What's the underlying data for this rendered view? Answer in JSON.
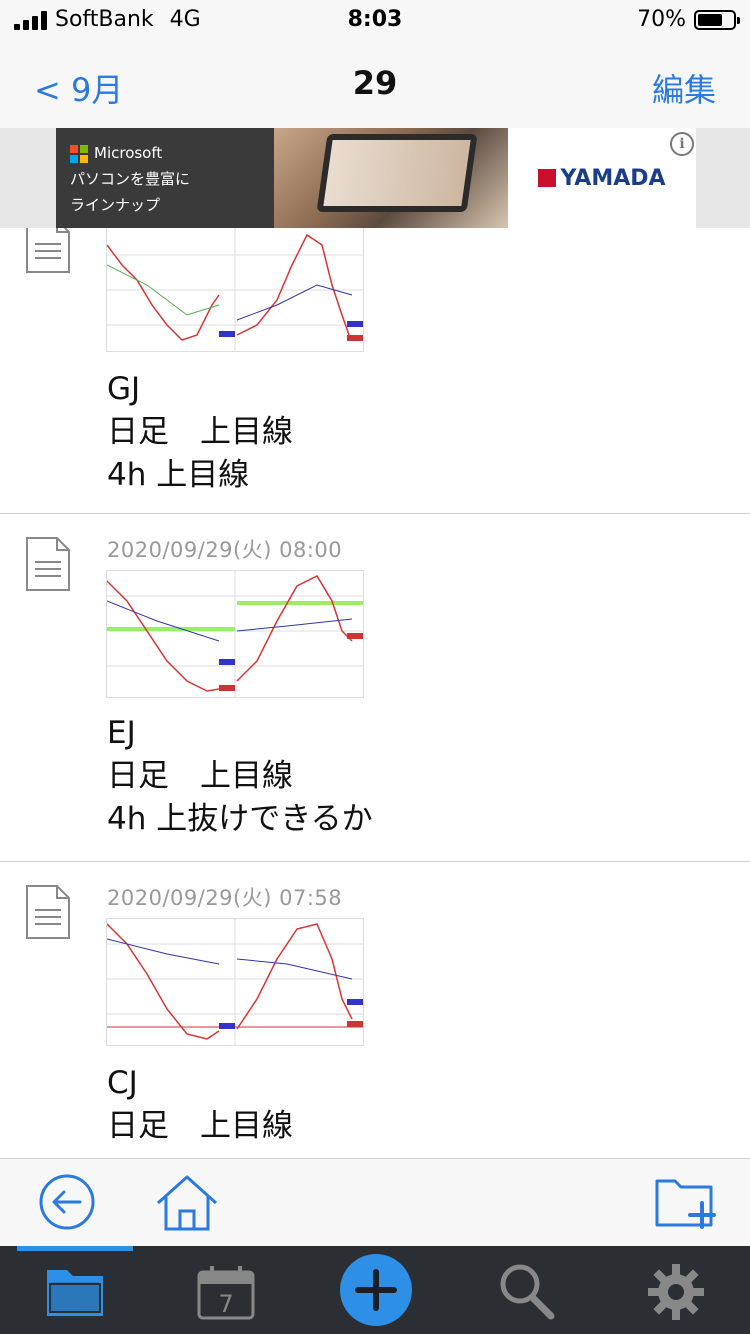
{
  "status": {
    "carrier": "SoftBank",
    "network": "4G",
    "time": "8:03",
    "battery": "70%",
    "battery_level": 0.7
  },
  "nav": {
    "back_label": "< 9月",
    "title": "29",
    "edit_label": "編集"
  },
  "ad": {
    "sponsor": "Microsoft",
    "line1": "パソコンを豊富に",
    "line2": "ラインナップ",
    "brand": "YAMADA",
    "info": "i"
  },
  "entries": [
    {
      "date": "",
      "lines": [
        "GJ",
        "日足　上目線",
        "4h 上目線"
      ]
    },
    {
      "date": "2020/09/29(火) 08:00",
      "lines": [
        "EJ",
        "日足　上目線",
        "4h 上抜けできるか"
      ]
    },
    {
      "date": "2020/09/29(火) 07:58",
      "lines": [
        "CJ",
        "日足　上目線"
      ]
    }
  ],
  "toolbar": {
    "back_icon": "circle-arrow-left-icon",
    "home_icon": "home-icon",
    "new_folder_icon": "folder-plus-icon"
  },
  "tabs": [
    {
      "name": "folder",
      "icon": "folder-icon",
      "active": true
    },
    {
      "name": "calendar",
      "icon": "calendar-icon",
      "label": "7"
    },
    {
      "name": "add",
      "icon": "plus-icon"
    },
    {
      "name": "search",
      "icon": "search-icon"
    },
    {
      "name": "settings",
      "icon": "gear-icon"
    }
  ],
  "colors": {
    "accent": "#2d8fe6",
    "link": "#2a7ae2",
    "tabbar_bg": "#2b2f33"
  }
}
